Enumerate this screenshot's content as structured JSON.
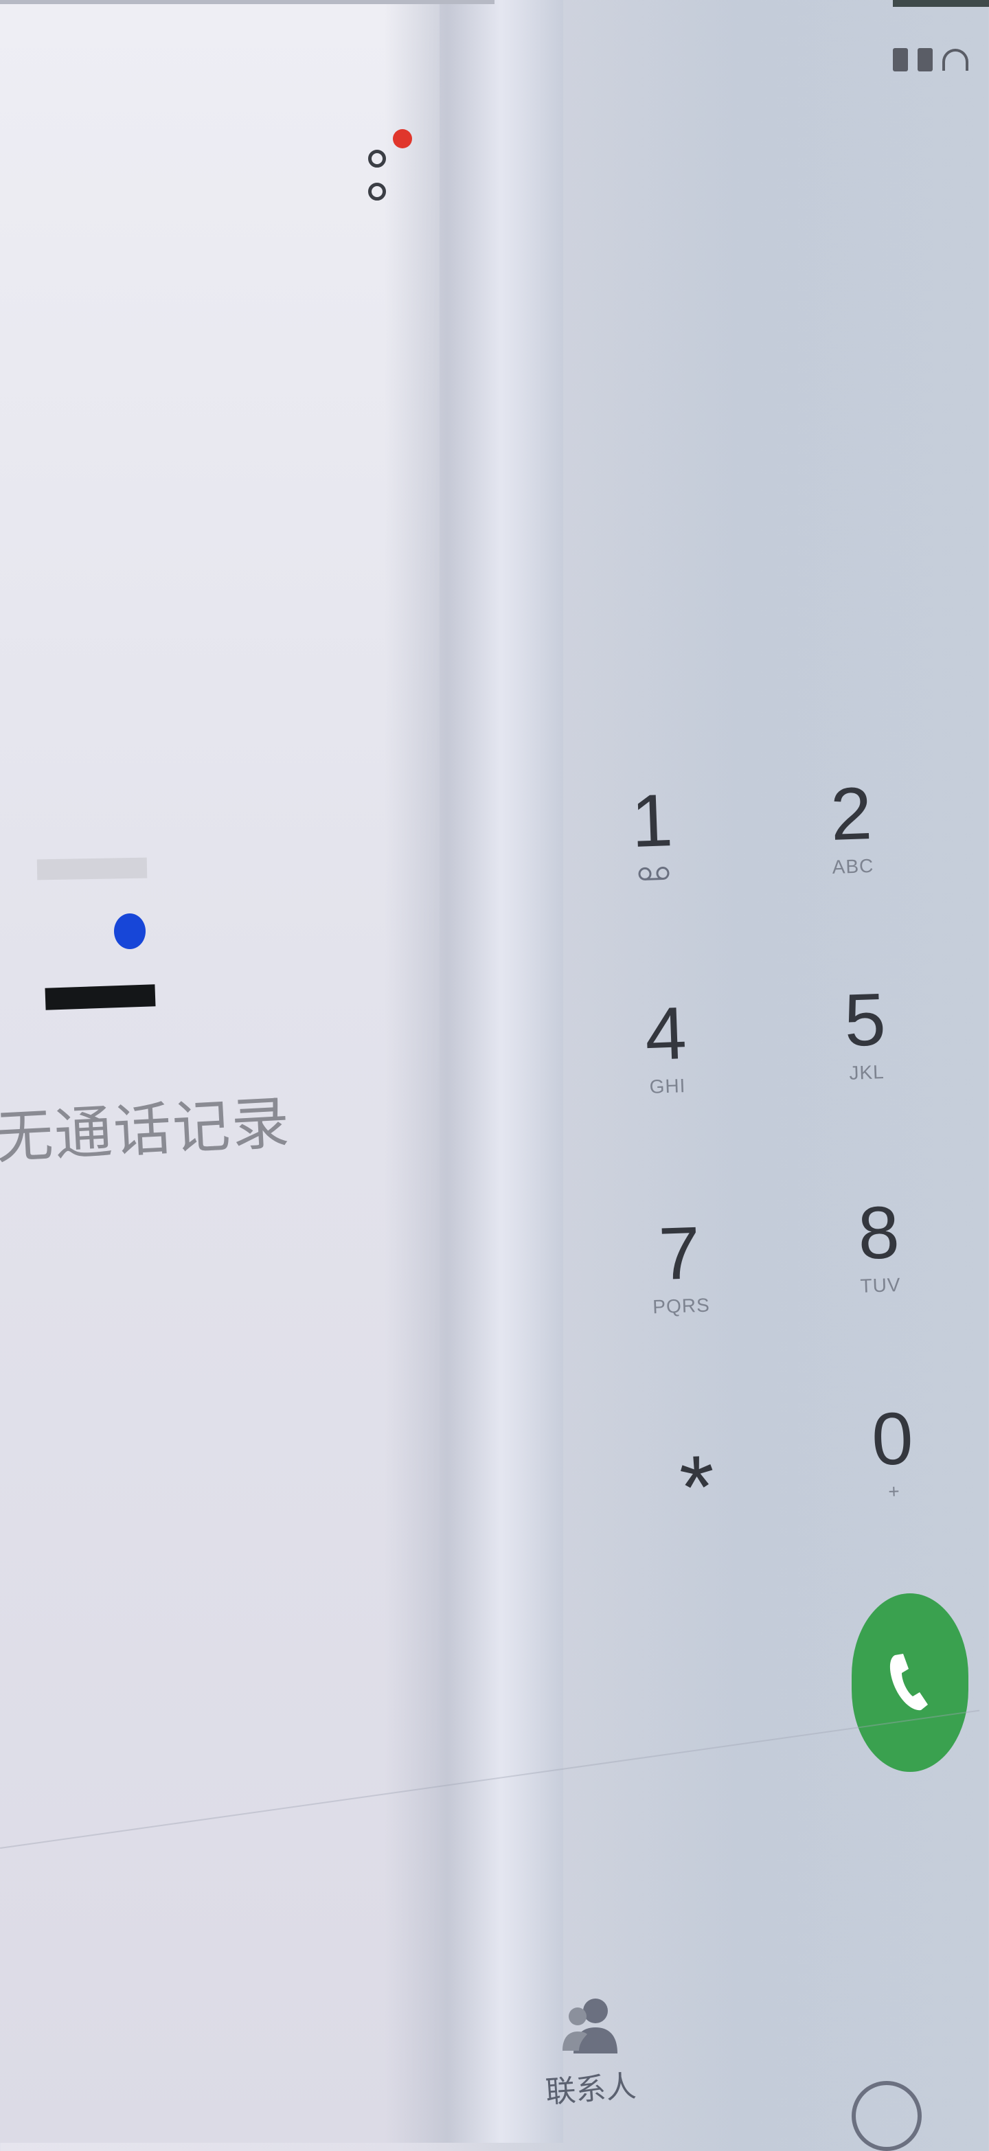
{
  "call_log": {
    "empty_text": "无通话记录",
    "more_icon": "more-dots-icon",
    "badge_color": "#e0362c"
  },
  "status_bar": {
    "icons": [
      "sim-icon",
      "battery-icon",
      "wifi-icon"
    ]
  },
  "dialpad": {
    "keys": [
      {
        "digit": "1",
        "letters": "",
        "icon": "voicemail-icon"
      },
      {
        "digit": "2",
        "letters": "ABC"
      },
      {
        "digit": "4",
        "letters": "GHI"
      },
      {
        "digit": "5",
        "letters": "JKL"
      },
      {
        "digit": "7",
        "letters": "PQRS"
      },
      {
        "digit": "8",
        "letters": "TUV"
      },
      {
        "digit": "*",
        "letters": ""
      },
      {
        "digit": "0",
        "letters": "+"
      }
    ],
    "call_button_color": "#3aa14f"
  },
  "bottom_nav": {
    "contacts_label": "联系人"
  }
}
